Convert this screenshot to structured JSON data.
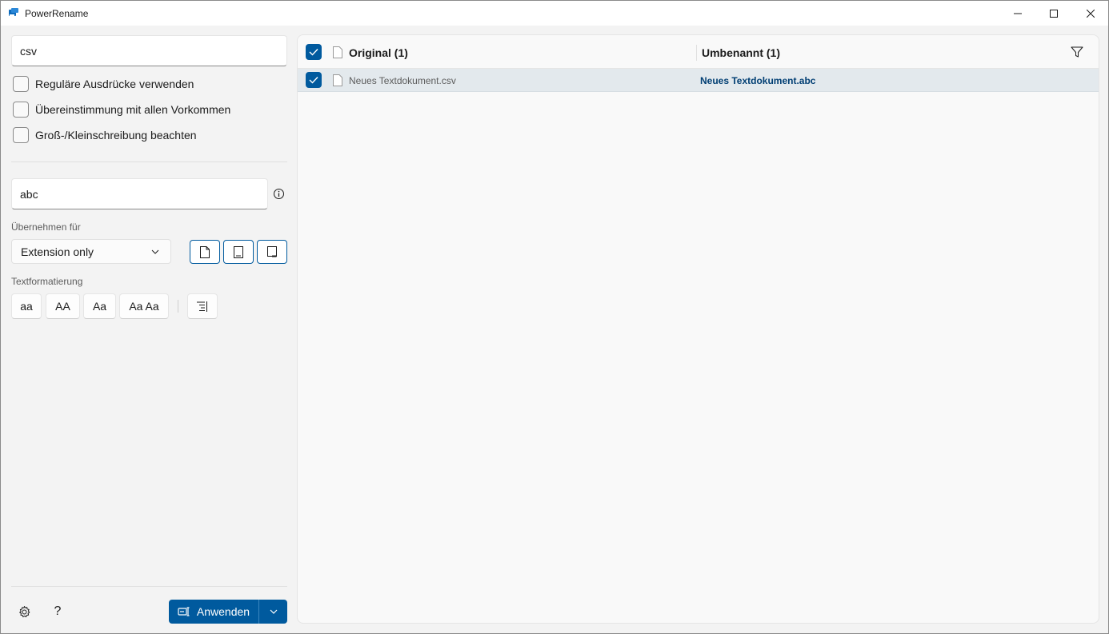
{
  "window": {
    "title": "PowerRename",
    "icons": {
      "app": "powerrename-app-icon",
      "minimize": "minimize-icon",
      "maximize": "maximize-icon",
      "close": "close-icon"
    }
  },
  "search": {
    "value": "csv"
  },
  "options": [
    {
      "label": "Reguläre Ausdrücke verwenden",
      "checked": false
    },
    {
      "label": "Übereinstimmung mit allen Vorkommen",
      "checked": false
    },
    {
      "label": "Groß-/Kleinschreibung beachten",
      "checked": false
    }
  ],
  "replace": {
    "value": "abc"
  },
  "apply_to": {
    "caption": "Übernehmen für",
    "selected": "Extension only",
    "toggles": [
      "include-files-icon",
      "include-folders-icon",
      "include-subfolders-icon"
    ]
  },
  "text_format": {
    "caption": "Textformatierung",
    "buttons": [
      "aa",
      "AA",
      "Aa",
      "Aa Aa"
    ],
    "enumerate_icon": "enumerate-items-icon"
  },
  "footer": {
    "settings_icon": "gear-icon",
    "help_label": "?",
    "apply_label": "Anwenden"
  },
  "list": {
    "header": {
      "original": "Original (1)",
      "renamed": "Umbenannt (1)"
    },
    "rows": [
      {
        "original": "Neues Textdokument.csv",
        "renamed": "Neues Textdokument.abc",
        "checked": true
      }
    ]
  },
  "colors": {
    "accent": "#005a9e",
    "row_selected": "#e3e9ed",
    "renamed_text": "#003e73"
  }
}
